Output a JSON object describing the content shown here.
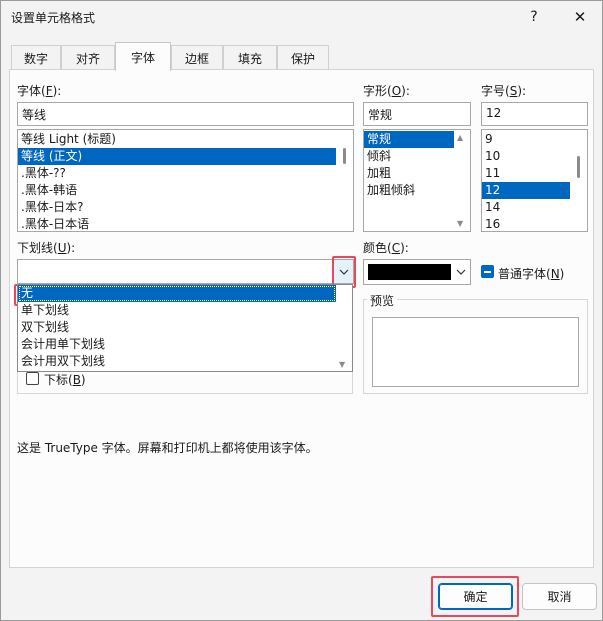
{
  "window": {
    "title": "设置单元格格式",
    "help_label": "?",
    "close_label": "✕"
  },
  "tabs": [
    {
      "label": "数字"
    },
    {
      "label": "对齐"
    },
    {
      "label": "字体",
      "active": true
    },
    {
      "label": "边框"
    },
    {
      "label": "填充"
    },
    {
      "label": "保护"
    }
  ],
  "font": {
    "label": "字体(",
    "hotkey": "F",
    "label_end": "):",
    "value": "等线",
    "items": [
      "等线 Light (标题)",
      "等线 (正文)",
      ".黑体-??",
      ".黑体-韩语",
      ".黑体-日本?",
      ".黑体-日本语"
    ],
    "selected_index": 1
  },
  "style": {
    "label": "字形(",
    "hotkey": "O",
    "label_end": "):",
    "value": "常规",
    "items": [
      "常规",
      "倾斜",
      "加粗",
      "加粗倾斜"
    ],
    "selected_index": 0
  },
  "size": {
    "label": "字号(",
    "hotkey": "S",
    "label_end": "):",
    "value": "12",
    "items": [
      "9",
      "10",
      "11",
      "12",
      "14",
      "16"
    ],
    "selected_index": 3
  },
  "underline": {
    "label": "下划线(",
    "hotkey": "U",
    "label_end": "):",
    "value": "",
    "options": [
      "无",
      "单下划线",
      "双下划线",
      "会计用单下划线",
      "会计用双下划线"
    ],
    "selected_index": 0
  },
  "color": {
    "label": "颜色(",
    "hotkey": "C",
    "label_end": "):",
    "swatch": "#000000",
    "normal_font_label": "普通字体(",
    "normal_font_hotkey": "N",
    "normal_font_end": ")",
    "normal_font_checked": true
  },
  "effects": {
    "subscript_label": "下标(",
    "subscript_hotkey": "B",
    "subscript_end": ")"
  },
  "preview": {
    "label": "预览"
  },
  "info_text": "这是 TrueType 字体。屏幕和打印机上都将使用该字体。",
  "buttons": {
    "ok": "确定",
    "cancel": "取消"
  },
  "colors": {
    "accent": "#0067c0",
    "highlight": "#e8485c"
  }
}
